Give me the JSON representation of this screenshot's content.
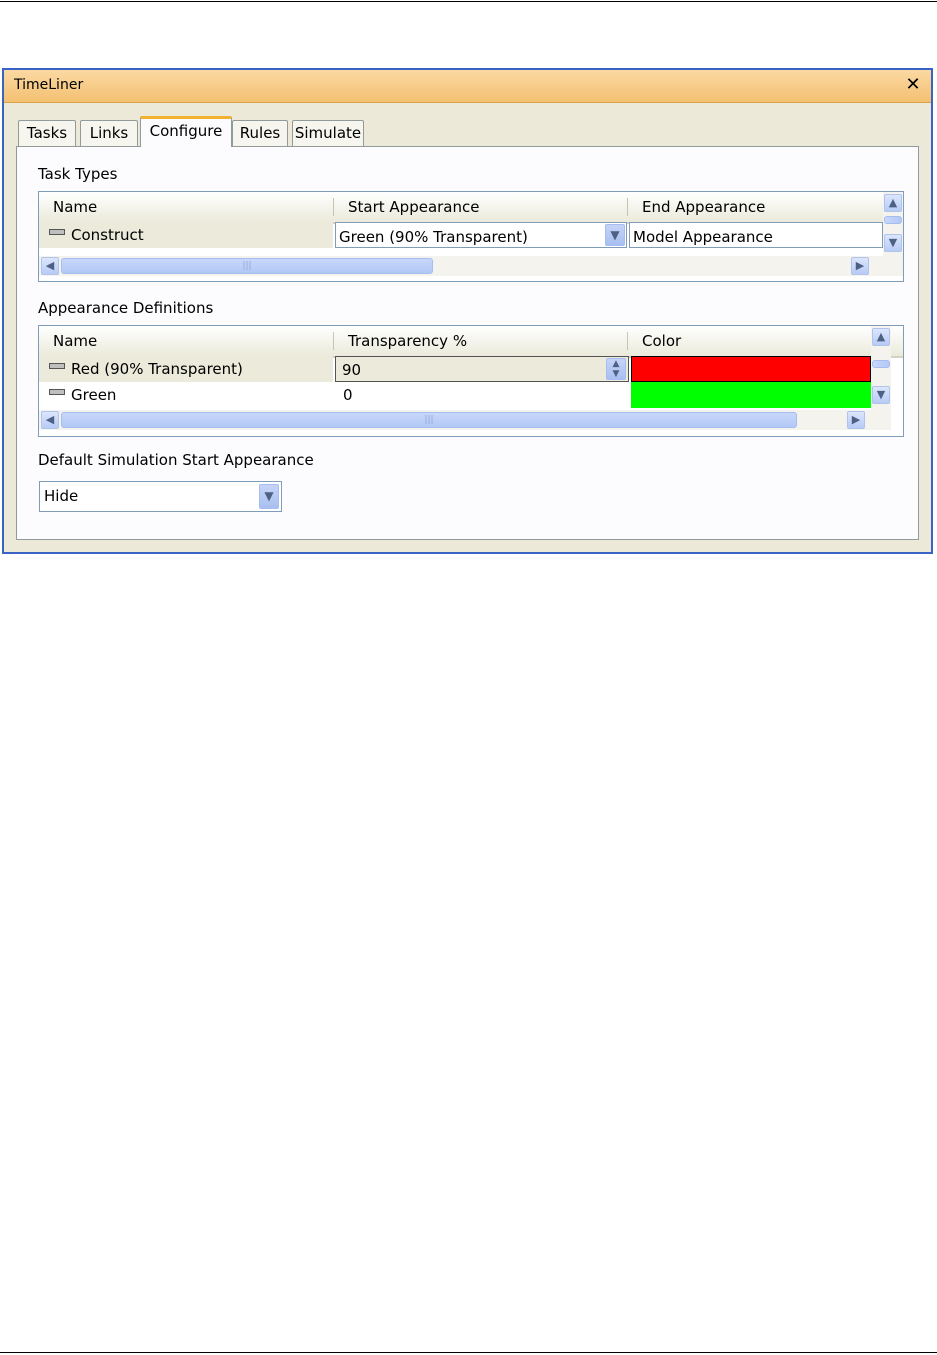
{
  "window": {
    "title": "TimeLiner"
  },
  "tabs": [
    {
      "label": "Tasks"
    },
    {
      "label": "Links"
    },
    {
      "label": "Configure",
      "active": true
    },
    {
      "label": "Rules"
    },
    {
      "label": "Simulate"
    }
  ],
  "task_types": {
    "label": "Task Types",
    "columns": [
      "Name",
      "Start Appearance",
      "End Appearance"
    ],
    "rows": [
      {
        "name": "Construct",
        "start": "Green (90% Transparent)",
        "end": "Model Appearance"
      }
    ]
  },
  "appearance_definitions": {
    "label": "Appearance Definitions",
    "columns": [
      "Name",
      "Transparency %",
      "Color"
    ],
    "rows": [
      {
        "name": "Red (90% Transparent)",
        "transparency": "90",
        "color": "#ff0000"
      },
      {
        "name": "Green",
        "transparency": "0",
        "color": "#00ff00"
      }
    ]
  },
  "default_start": {
    "label": "Default Simulation Start Appearance",
    "value": "Hide"
  },
  "icons": {
    "close": "close-icon",
    "dropdown": "chevron-down-icon",
    "spinner": "spinner-updown-icon",
    "scroll_up": "chevron-up-icon",
    "scroll_down": "chevron-down-icon",
    "scroll_left": "chevron-left-icon",
    "scroll_right": "chevron-right-icon",
    "row": "row-indicator-icon"
  }
}
